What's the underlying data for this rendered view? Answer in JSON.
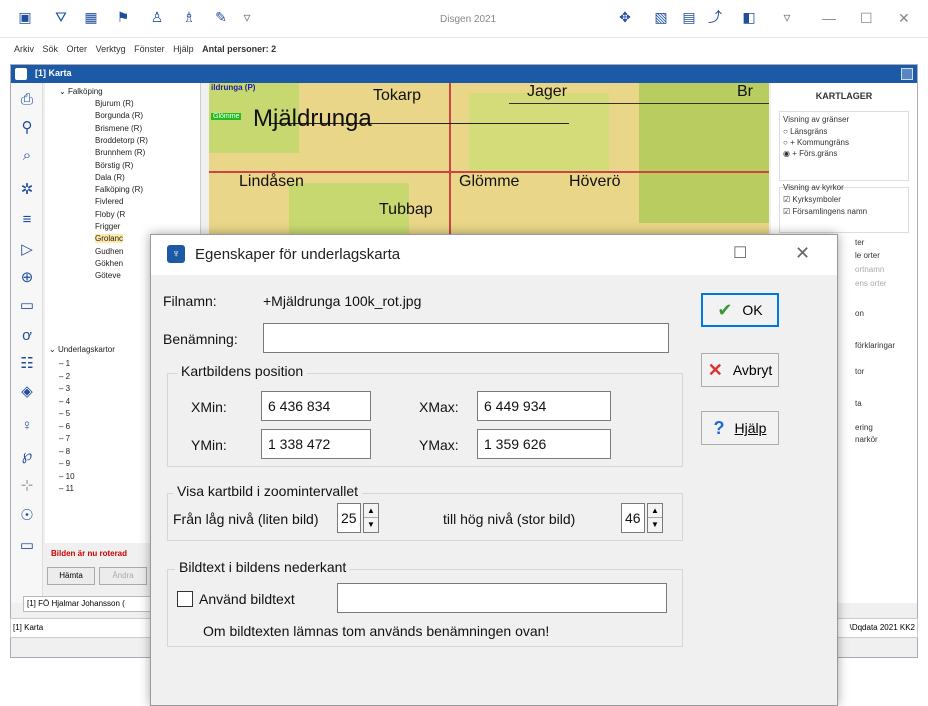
{
  "app": {
    "title": "Disgen 2021"
  },
  "menu": [
    "Arkiv",
    "Sök",
    "Orter",
    "Verktyg",
    "Fönster",
    "Hjälp"
  ],
  "menu_status": "Antal personer: 2",
  "mapwin": {
    "title": "[1] Karta"
  },
  "tree": {
    "parent": "Falköping",
    "items": [
      "Bjurum (R)",
      "Borgunda (R)",
      "Brismene (R)",
      "Broddetorp (R)",
      "Brunnhem (R)",
      "Börstig (R)",
      "Dala (R)",
      "Falköping (R)",
      "Fivlered",
      "Floby (R",
      "Frigger",
      "Grolanc",
      "Gudhen",
      "Gökhen",
      "Göteve"
    ],
    "selected_index": 11,
    "section2": "Underlagskartor",
    "numbers": [
      "1",
      "2",
      "3",
      "4",
      "5",
      "6",
      "7",
      "8",
      "9",
      "10",
      "11"
    ]
  },
  "map_labels": {
    "a": "ildrunga (P)",
    "b": "Glömme",
    "c": "Mjäldrunga",
    "d": "Tokarp",
    "e": "Jager",
    "f": "Br",
    "g": "Lindåsen",
    "h": "Glömme",
    "i": "Höverö",
    "j": "Tubbap"
  },
  "rpanel": {
    "title": "KARTLAGER",
    "g1": "Visning av gränser",
    "r1": "Länsgräns",
    "r2": "+ Kommungräns",
    "r3": "+ Förs.gräns",
    "g2": "Visning av kyrkor",
    "c1": "Kyrksymboler",
    "c2": "Församlingens namn",
    "p1": "ter",
    "p2": "le orter",
    "p3": "ortnamn",
    "p4": "ens orter",
    "p5": "on",
    "p6": "förklaringar",
    "p7": "tor",
    "p8": "ta",
    "p9": "ering",
    "p10": "narkör"
  },
  "bottom": {
    "warn": "Bilden är nu roterad",
    "hamta": "Hämta",
    "andra": "Ändra",
    "path": "[1] FÖ Hjalmar Johansson (",
    "status_left": "[1] Karta",
    "status_right": "\\Dqdata 2021 KK2"
  },
  "dialog": {
    "title": "Egenskaper för underlagskarta",
    "filnamn_label": "Filnamn:",
    "filnamn_value": "+Mjäldrunga 100k_rot.jpg",
    "benamning_label": "Benämning:",
    "benamning_value": "",
    "pos_group": "Kartbildens position",
    "xmin_label": "XMin:",
    "xmin": "6 436 834",
    "xmax_label": "XMax:",
    "xmax": "6 449 934",
    "ymin_label": "YMin:",
    "ymin": "1 338 472",
    "ymax_label": "YMax:",
    "ymax": "1 359 626",
    "zoom_group": "Visa kartbild i zoomintervallet",
    "low_label": "Från låg nivå (liten bild)",
    "low_value": "25",
    "high_label": "till hög nivå (stor bild)",
    "high_value": "46",
    "caption_group": "Bildtext i bildens nederkant",
    "use_caption": "Använd bildtext",
    "caption_value": "",
    "hint": "Om bildtexten lämnas tom används benämningen ovan!",
    "ok": "OK",
    "cancel": "Avbryt",
    "help": "Hjälp"
  }
}
